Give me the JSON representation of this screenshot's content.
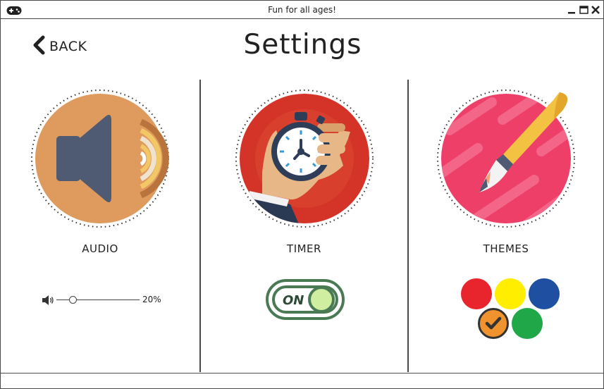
{
  "window": {
    "title": "Fun for all ages!"
  },
  "nav": {
    "back_label": "BACK"
  },
  "page": {
    "title": "Settings"
  },
  "panels": {
    "audio": {
      "label": "AUDIO",
      "volume_percent": 20,
      "volume_text": "20%"
    },
    "timer": {
      "label": "TIMER",
      "toggle_text": "ON",
      "toggle_on": true
    },
    "themes": {
      "label": "THEMES",
      "swatches": [
        {
          "color": "#e8242c",
          "selected": false
        },
        {
          "color": "#ffee00",
          "selected": false
        },
        {
          "color": "#1e4fa0",
          "selected": false
        },
        {
          "color": "#f0922d",
          "selected": true
        },
        {
          "color": "#20a848",
          "selected": false
        }
      ]
    }
  },
  "colors": {
    "audio_bg": "#df9a5e",
    "timer_bg": "#d33427",
    "themes_bg": "#ee3f69",
    "toggle_green": "#4a7a54",
    "toggle_knob": "#cfeea0"
  },
  "icons": {
    "app": "gamepad-icon",
    "back": "chevron-left-icon",
    "audio": "speaker-icon",
    "timer": "stopwatch-icon",
    "themes": "paintbrush-icon",
    "volume": "volume-icon",
    "selected": "checkmark-icon"
  }
}
